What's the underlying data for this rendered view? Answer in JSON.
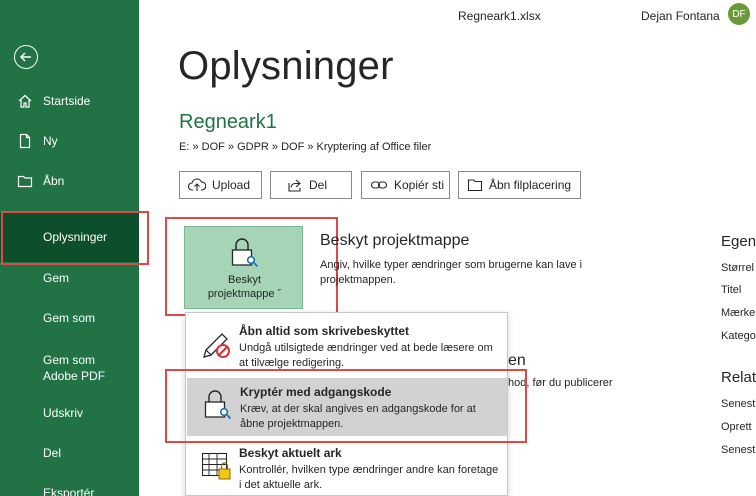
{
  "header": {
    "filename": "Regneark1.xlsx",
    "user_name": "Dejan Fontana",
    "user_initials": "DF"
  },
  "sidebar": {
    "items": [
      {
        "label": "Startside",
        "icon": "home-icon"
      },
      {
        "label": "Ny",
        "icon": "new-file-icon"
      },
      {
        "label": "Åbn",
        "icon": "folder-icon"
      },
      {
        "label": "Oplysninger",
        "selected": true
      },
      {
        "label": "Gem"
      },
      {
        "label": "Gem som"
      },
      {
        "label": "Gem som Adobe PDF"
      },
      {
        "label": "Udskriv"
      },
      {
        "label": "Del"
      },
      {
        "label": "Eksportér"
      }
    ]
  },
  "main": {
    "title": "Oplysninger",
    "doc_name": "Regneark1",
    "breadcrumb": "E: » DOF » GDPR » DOF » Kryptering af Office filer",
    "actions": [
      {
        "label": "Upload",
        "icon": "upload-icon"
      },
      {
        "label": "Del",
        "icon": "share-icon"
      },
      {
        "label": "Kopiér sti",
        "icon": "link-icon"
      },
      {
        "label": "Åbn filplacering",
        "icon": "folder-open-icon"
      }
    ],
    "protect": {
      "button_line1": "Beskyt",
      "button_line2": "projektmappe ˇ",
      "title": "Beskyt projektmappe",
      "description": "Angiv, hvilke typer ændringer som brugerne kan lave i projektmappen."
    },
    "bg_heading_2_fragment": "en",
    "bg_text_2_fragment": "hod, før du publicerer"
  },
  "dropdown": {
    "items": [
      {
        "title": "Åbn altid som skrivebeskyttet",
        "description": "Undgå utilsigtede ændringer ved at bede læsere om at tilvælge redigering."
      },
      {
        "title": "Kryptér med adgangskode",
        "description": "Kræv, at der skal angives en adgangskode for at åbne projektmappen."
      },
      {
        "title": "Beskyt aktuelt ark",
        "description": "Kontrollér, hvilken type ændringer andre kan foretage i det aktuelle ark."
      }
    ]
  },
  "right_panel": {
    "heading_1": "Egens",
    "rows_1": [
      "Størrel",
      "Titel",
      "Mærke",
      "Katego"
    ],
    "heading_2": "Relat",
    "rows_2": [
      "Senest",
      "Oprett",
      "Senest"
    ]
  },
  "colors": {
    "sidebar": "#217346",
    "sidebar_selected": "#0e4f2b",
    "accent_text": "#217346",
    "highlight_box": "#e04848",
    "protect_button": "#a6d4b6",
    "dropdown_hover": "#d2d2d2"
  }
}
